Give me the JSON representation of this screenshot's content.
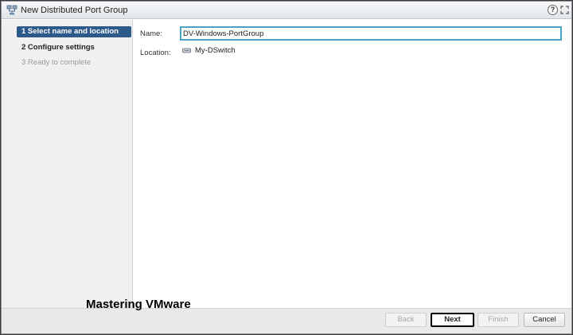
{
  "dialog": {
    "title": "New Distributed Port Group",
    "help_label": "?"
  },
  "steps": [
    {
      "label": "1  Select name and location",
      "state": "active"
    },
    {
      "label": "2  Configure settings",
      "state": "normal"
    },
    {
      "label": "3  Ready to complete",
      "state": "disabled"
    }
  ],
  "form": {
    "name_label": "Name:",
    "name_value": "DV-Windows-PortGroup",
    "location_label": "Location:",
    "location_value": "My-DSwitch"
  },
  "watermark": "Mastering VMware",
  "buttons": {
    "back": "Back",
    "next": "Next",
    "finish": "Finish",
    "cancel": "Cancel"
  }
}
